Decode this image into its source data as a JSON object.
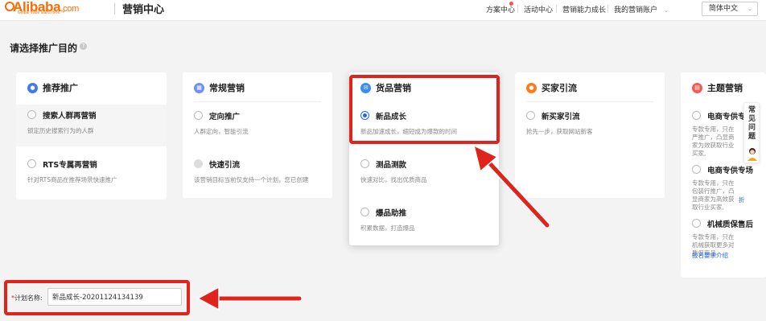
{
  "header": {
    "logo_text": "Alibaba",
    "logo_suffix": ".com",
    "logo_tagline": "Global trade starts here.™",
    "title": "营销中心",
    "nav": [
      "方案中心",
      "活动中心",
      "营销能力成长",
      "我的营销账户"
    ],
    "language": "简体中文"
  },
  "page_title": "请选择推广目的",
  "cards": [
    {
      "title": "推荐推广",
      "icon": "user-icon",
      "icon_color": "#3d7bf5",
      "options": [
        {
          "title": "搜索人群再营销",
          "desc": "锁定历史搜索行为的人群",
          "state": "unchecked"
        },
        {
          "title": "RTS专属再营销",
          "desc": "针对RTS商品在推荐场景快速推广",
          "state": "unchecked"
        }
      ]
    },
    {
      "title": "常规营销",
      "icon": "grid-icon",
      "icon_color": "#6f8ff2",
      "options": [
        {
          "title": "定向推广",
          "desc": "人群定向，智能引流",
          "state": "unchecked"
        },
        {
          "title": "快速引流",
          "desc": "该营销目标当前仅支持一个计划，您已创建",
          "state": "disabled"
        }
      ]
    },
    {
      "title": "货品营销",
      "icon": "goods-icon",
      "icon_color": "#3a8ef7",
      "options": [
        {
          "title": "新品成长",
          "desc": "新品加速成长，缩短成为爆款的时间",
          "state": "checked"
        },
        {
          "title": "测品测款",
          "desc": "快速对比，找出优质商品",
          "state": "unchecked"
        },
        {
          "title": "爆品助推",
          "desc": "积累数据，打造爆品",
          "state": "unchecked"
        }
      ]
    },
    {
      "title": "买家引流",
      "icon": "buyer-icon",
      "icon_color": "#ff7a1a",
      "options": [
        {
          "title": "新买家引流",
          "desc": "抢先一步，获取网站新客",
          "state": "unchecked"
        }
      ]
    },
    {
      "title": "主题营销",
      "icon": "theme-icon",
      "icon_color": "#f25c54",
      "options": [
        {
          "title": "电商专供专",
          "desc": "专款专用，只在严推广，凸显商家为效获取行业买家,",
          "link": "",
          "state": "unchecked"
        },
        {
          "title": "电商专供专场",
          "desc": "专款专用，只在包装行推广，凸显商家为高效获取行业买家,",
          "link": "折",
          "state": "unchecked"
        },
        {
          "title": "机械质保售后",
          "desc": "专款专用，只在机械获取更多对质保商品",
          "link": "报名要求介绍",
          "state": "unchecked"
        }
      ]
    }
  ],
  "side_widget": {
    "label": "常见问题"
  },
  "plan": {
    "label_required": "*",
    "label": "计划名称:",
    "value": "新品成长-20201124134139"
  },
  "colors": {
    "accent": "#1a66ff",
    "annotation": "#e0241c",
    "brand": "#ff6a00"
  }
}
